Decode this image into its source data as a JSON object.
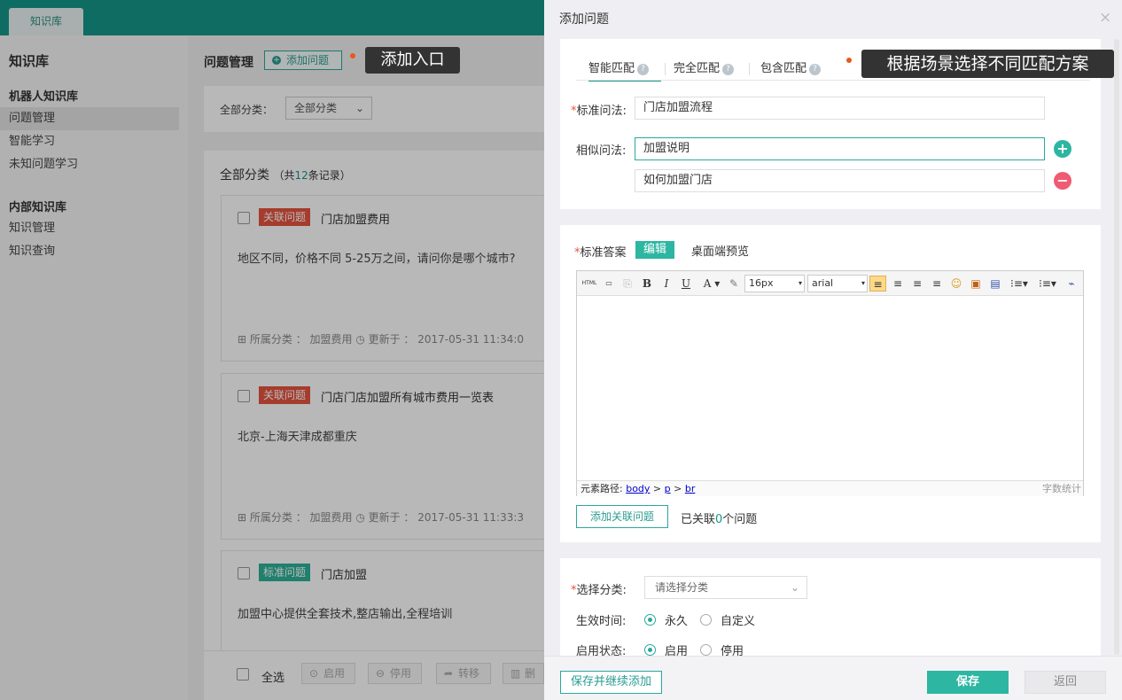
{
  "app": {
    "tab": "知识库"
  },
  "sidebar": {
    "title": "知识库",
    "groups": [
      {
        "label": "机器人知识库",
        "items": [
          "问题管理",
          "智能学习",
          "未知问题学习"
        ]
      },
      {
        "label": "内部知识库",
        "items": [
          "知识管理",
          "知识查询"
        ]
      }
    ]
  },
  "main": {
    "title": "问题管理",
    "add_button": "添加问题",
    "filter_label": "全部分类：",
    "filter_value": "全部分类",
    "list_title": "全部分类",
    "count_prefix": "（共",
    "count": "12",
    "count_suffix": "条记录）",
    "cards": [
      {
        "tag": "关联问题",
        "title": "门店加盟费用",
        "body": "地区不同，价格不同 5-25万之间，请问你是哪个城市?",
        "meta": "所属分类 ： 加盟费用 ◷ 更新于 ： 2017-05-31 11:34:0"
      },
      {
        "tag": "关联问题",
        "title": "门店门店加盟所有城市费用一览表",
        "body": "北京-上海天津成都重庆",
        "meta": "所属分类 ： 加盟费用 ◷ 更新于 ： 2017-05-31 11:33:3"
      },
      {
        "tag": "标准问题",
        "title": "门店加盟",
        "body": "加盟中心提供全套技术,整店输出,全程培训",
        "meta": ""
      }
    ],
    "bottom": {
      "select_all": "全选",
      "enable": "启用",
      "disable": "停用",
      "move": "转移",
      "delete": "删除"
    }
  },
  "callouts": {
    "entry": "添加入口",
    "match": "根据场景选择不同匹配方案"
  },
  "panel": {
    "title": "添加问题",
    "close": "×",
    "tabs": [
      "智能匹配",
      "完全匹配",
      "包含匹配"
    ],
    "help": "?",
    "std_q_label": "标准问法:",
    "std_q_value": "门店加盟流程",
    "sim_q_label": "相似问法:",
    "sim_q_values": [
      "加盟说明",
      "如何加盟门店"
    ],
    "answer_label": "标准答案",
    "edit_label": "编辑",
    "preview_label": "桌面端预览",
    "toolbar": {
      "html": "HTML",
      "font_size": "16px",
      "font_family": "arial"
    },
    "status_prefix": "元素路径:",
    "status_path": [
      "body",
      "p",
      "br"
    ],
    "word_count": "字数统计",
    "link_button": "添加关联问题",
    "linked_prefix": "已关联",
    "linked_count": "0",
    "linked_suffix": "个问题",
    "category_label": "选择分类:",
    "category_placeholder": "请选择分类",
    "time_label": "生效时间:",
    "time_options": [
      "永久",
      "自定义"
    ],
    "state_label": "启用状态:",
    "state_options": [
      "启用",
      "停用"
    ],
    "save_continue": "保存并继续添加",
    "save": "保存",
    "back": "返回"
  },
  "colors": {
    "brand": "#14968a",
    "accent": "#2db6a1",
    "danger": "#e5543f",
    "callout": "#333333"
  }
}
